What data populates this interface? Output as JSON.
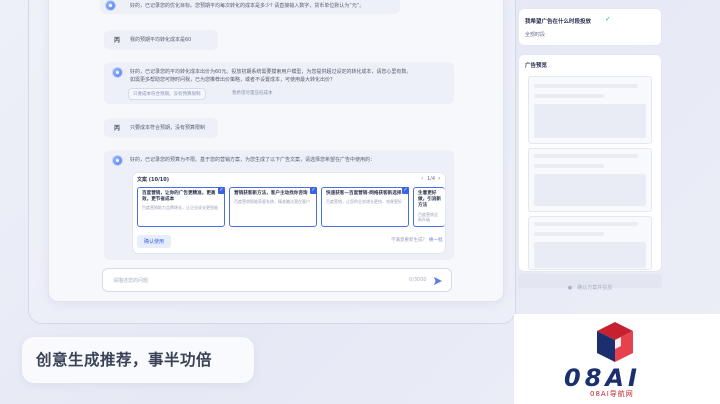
{
  "chat": {
    "msg1": "好的，已记录您的优化目标。您预期平均每次转化的成本是多少? 请直接输入数字，货币单位默认为“元”。",
    "user1_tag": "丙",
    "user1": "我的预期平均转化成本是60",
    "msg2_line1": "好的，已记录您的平均转化成本出价为60元。投放初期系统需要摸索用户模型，为您提供超过设定的转化成本，请您心里有数。",
    "msg2_line2": "如需更多帮助您可随时问我，已为您推荐出价策略，或者不设置成本，可使用最大转化出价？",
    "option1": "只要成本符合预期，没有预算限制",
    "option2": "我希望尽量压低成本",
    "user2_tag": "丙",
    "user2": "只要成本符合预期，没有预算限制",
    "msg3": "好的，已记录您的预算为不限。基于您的营销方案，为您生成了以下广告文案，请选择您希望在广告中使用的：",
    "panel_title": "文案 (10/10)",
    "pager": "1/4",
    "cards": [
      {
        "title": "百度营销，让你的广告更精准，更高效，更节省成本",
        "desc": "百度营销助力品牌增长，让企业成长更智能"
      },
      {
        "title": "营销获客新方法，客户主动找你咨询",
        "desc": "百度营销智能获客系统，精准触达潜在客户"
      },
      {
        "title": "快速获客—百度营销-网络获客新选择",
        "desc": "百度营销，让您的业务增长更快，效果更好"
      },
      {
        "title": "生意更好做，引流新方法",
        "desc": "百度营销全新升级"
      }
    ],
    "confirm_btn": "确认使用",
    "not_satisfied": "不满意重新生成?",
    "regen_link": "换一批",
    "input_placeholder": "请描述您的问题",
    "char_count": "0/3000"
  },
  "sidebar": {
    "question": "我希望广告在什么时段投放",
    "answer": "全部时段",
    "preview_title": "广告预览",
    "confirm_btn": "确认方案并投放"
  },
  "caption": "创意生成推荐，事半功倍",
  "logo": {
    "brand": "08AI",
    "subtitle": "08AI导航网"
  }
}
